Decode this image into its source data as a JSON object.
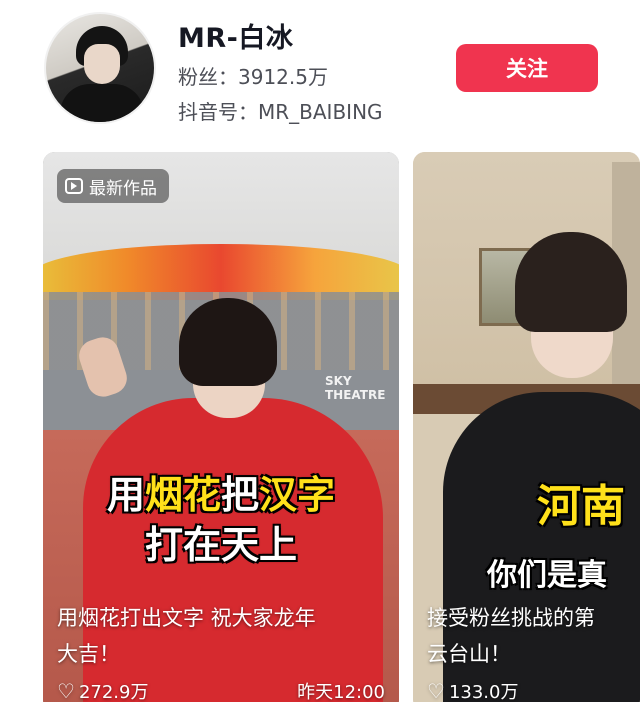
{
  "profile": {
    "name": "MR-白冰",
    "fans": "粉丝：3912.5万",
    "douyin_id": "抖音号：MR_BAIBING",
    "follow_label": "关注",
    "accent_color": "#f0344f"
  },
  "videos": [
    {
      "badge": "最新作品",
      "badge_icon": "video-icon",
      "overlay_line1_parts": [
        "用",
        "烟花",
        "把",
        "汉字"
      ],
      "overlay_line2": "打在天上",
      "scene_sign": "SKY\nTHEATRE",
      "title_line1": "用烟花打出文字 祝大家龙年",
      "title_line2": "大吉！",
      "likes": "272.9万",
      "time": "昨天12:00"
    },
    {
      "overlay_line1": "河南",
      "overlay_line2": "你们是真",
      "title_line1": "接受粉丝挑战的第",
      "title_line2": "云台山！",
      "likes": "133.0万"
    }
  ]
}
